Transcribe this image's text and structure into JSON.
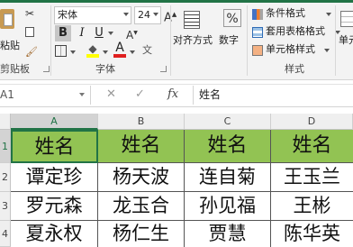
{
  "ribbon": {
    "clipboard": {
      "paste_label": "粘贴",
      "group_label": "剪贴板"
    },
    "font": {
      "font_name": "宋体",
      "font_size": "24",
      "grow_label": "A",
      "shrink_label": "A",
      "bold": "B",
      "italic": "I",
      "underline": "U",
      "color_label": "A",
      "group_label": "字体"
    },
    "alignment": {
      "label": "对齐方式"
    },
    "number": {
      "percent": "%",
      "label": "数字"
    },
    "styles": {
      "conditional": "条件格式",
      "table": "套用表格格式",
      "cell": "单元格样式",
      "group_label": "样式"
    },
    "cells": {
      "label": "单元"
    }
  },
  "formula_bar": {
    "name_box": "A1",
    "cancel": "✕",
    "enter": "✓",
    "fx": "fx",
    "content": "姓名"
  },
  "sheet": {
    "columns": [
      "A",
      "B",
      "C",
      "D"
    ],
    "rows": [
      "1",
      "2",
      "3",
      "4"
    ],
    "header": [
      "姓名",
      "姓名",
      "姓名",
      "姓名"
    ],
    "data": [
      [
        "谭定珍",
        "杨天波",
        "连自菊",
        "王玉兰"
      ],
      [
        "罗元森",
        "龙玉合",
        "孙见福",
        "王彬"
      ],
      [
        "夏永权",
        "杨仁生",
        "贾慧",
        "陈华英"
      ]
    ]
  },
  "colors": {
    "accent": "#217346",
    "header_fill": "#92c353",
    "font_color_underline": "#e02020",
    "highlight_underline": "#ffff00"
  }
}
